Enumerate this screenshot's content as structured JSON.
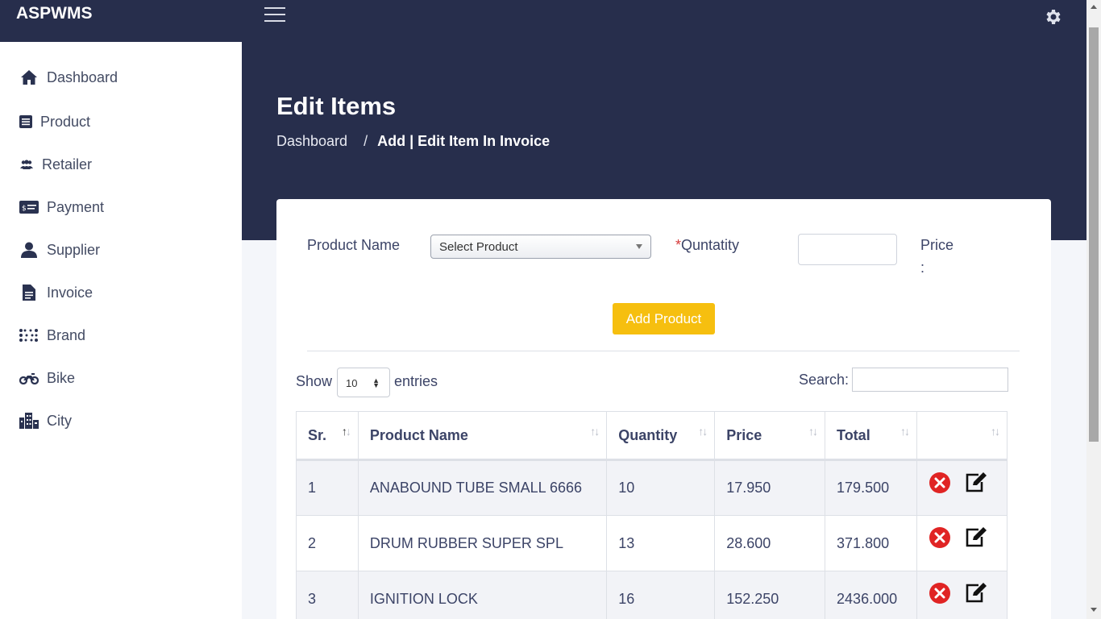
{
  "app": {
    "brand": "ASPWMS"
  },
  "sidebar": {
    "items": [
      {
        "label": "Dashboard",
        "icon": "home-icon"
      },
      {
        "label": "Product",
        "icon": "list-icon"
      },
      {
        "label": "Retailer",
        "icon": "users-icon"
      },
      {
        "label": "Payment",
        "icon": "money-check-icon"
      },
      {
        "label": "Supplier",
        "icon": "user-icon"
      },
      {
        "label": "Invoice",
        "icon": "file-icon"
      },
      {
        "label": "Brand",
        "icon": "dots-grid-icon"
      },
      {
        "label": "Bike",
        "icon": "motorcycle-icon"
      },
      {
        "label": "City",
        "icon": "city-icon"
      }
    ]
  },
  "header": {
    "title": "Edit Items",
    "breadcrumb": {
      "home": "Dashboard",
      "separator": "/",
      "current": "Add | Edit Item In Invoice"
    }
  },
  "form": {
    "product_label": "Product Name",
    "product_select": "Select Product",
    "qty_required": "*",
    "qty_label": "Quntatity",
    "qty_value": "",
    "price_label": "Price",
    "price_colon": ":",
    "add_button": "Add Product"
  },
  "table_controls": {
    "show_label": "Show",
    "page_length": "10",
    "entries_label": "entries",
    "search_label": "Search:",
    "search_value": ""
  },
  "table": {
    "columns": [
      "Sr.",
      "Product Name",
      "Quantity",
      "Price",
      "Total",
      ""
    ],
    "rows": [
      {
        "sr": "1",
        "name": "ANABOUND TUBE SMALL 6666",
        "qty": "10",
        "price": "17.950",
        "total": "179.500"
      },
      {
        "sr": "2",
        "name": "DRUM RUBBER SUPER SPL",
        "qty": "13",
        "price": "28.600",
        "total": "371.800"
      },
      {
        "sr": "3",
        "name": "IGNITION LOCK",
        "qty": "16",
        "price": "152.250",
        "total": "2436.000"
      }
    ]
  },
  "colors": {
    "header_bg": "#272e4c",
    "accent": "#f6bf0f",
    "delete": "#e02424"
  }
}
